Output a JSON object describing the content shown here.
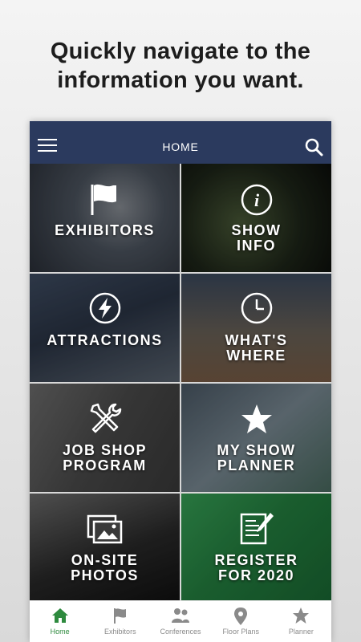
{
  "headline": {
    "line1": "Quickly navigate to the",
    "line2": "information you want."
  },
  "topbar": {
    "title": "HOME",
    "menu_icon": "hamburger-menu-icon",
    "search_icon": "search-icon"
  },
  "tiles": [
    {
      "label": "EXHIBITORS",
      "icon": "flag-icon"
    },
    {
      "label": "SHOW\nINFO",
      "icon": "info-icon"
    },
    {
      "label": "ATTRACTIONS",
      "icon": "lightning-icon"
    },
    {
      "label": "WHAT'S\nWHERE",
      "icon": "clock-icon"
    },
    {
      "label": "JOB SHOP\nPROGRAM",
      "icon": "tools-icon"
    },
    {
      "label": "MY SHOW\nPLANNER",
      "icon": "star-icon"
    },
    {
      "label": "ON-SITE\nPHOTOS",
      "icon": "photos-icon"
    },
    {
      "label": "REGISTER\nFOR 2020",
      "icon": "register-form-icon"
    }
  ],
  "bottom_nav": [
    {
      "label": "Home",
      "icon": "home-icon",
      "active": true
    },
    {
      "label": "Exhibitors",
      "icon": "flag-icon",
      "active": false
    },
    {
      "label": "Conferences",
      "icon": "people-icon",
      "active": false
    },
    {
      "label": "Floor Plans",
      "icon": "map-pin-icon",
      "active": false
    },
    {
      "label": "Planner",
      "icon": "star-icon",
      "active": false
    }
  ],
  "colors": {
    "topbar": "#2b3a5e",
    "active_nav": "#2e8a3e",
    "inactive_nav": "#8a8a8a"
  }
}
